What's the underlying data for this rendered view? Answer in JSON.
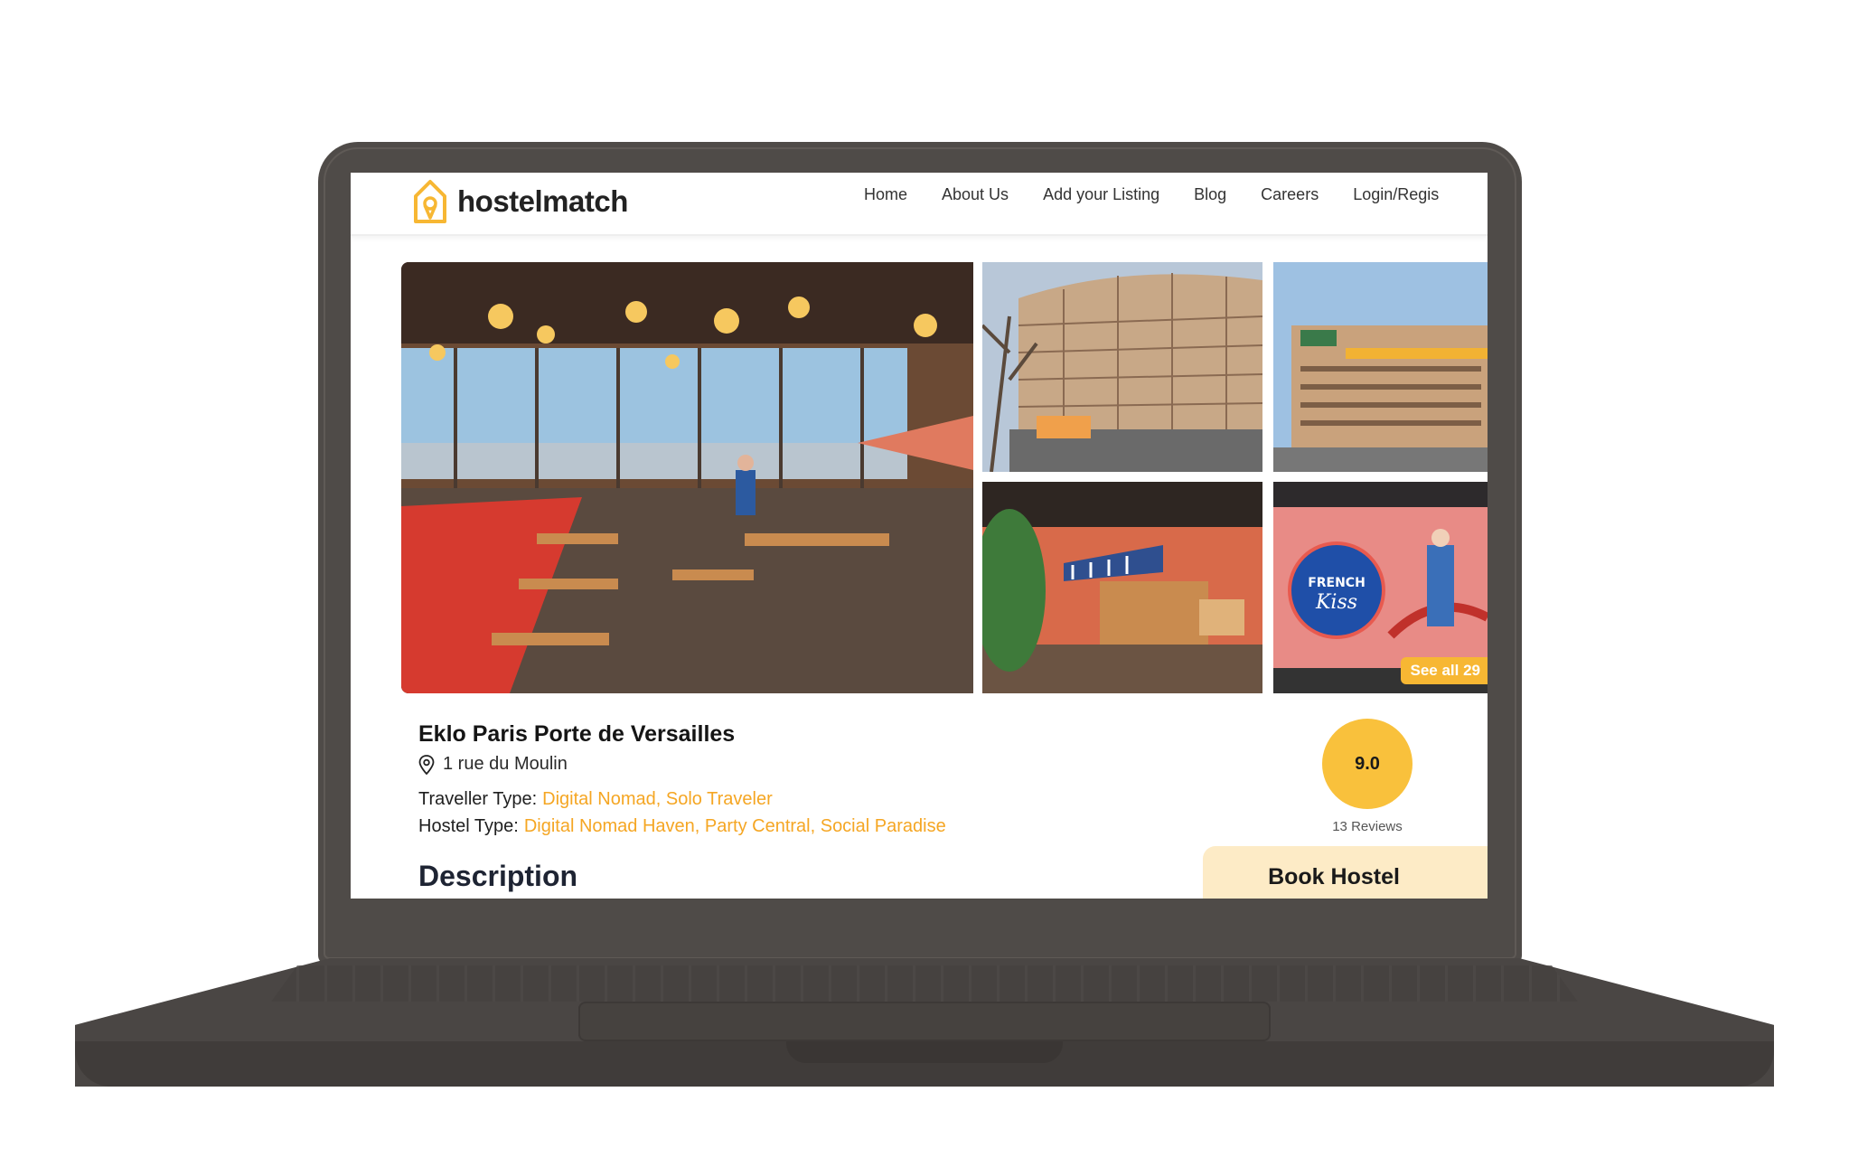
{
  "brand": {
    "name": "hostelmatch",
    "accent": "#f7b733",
    "icon": "house-pin-logo-icon"
  },
  "nav": {
    "items": [
      "Home",
      "About Us",
      "Add your Listing",
      "Blog",
      "Careers",
      "Login/Regis"
    ]
  },
  "gallery": {
    "see_all": "See all 29",
    "photos": [
      {
        "name": "restaurant-photo"
      },
      {
        "name": "building-exterior-photo"
      },
      {
        "name": "building-facade-photo"
      },
      {
        "name": "lobby-bar-photo"
      },
      {
        "name": "french-kiss-mural-photo"
      }
    ]
  },
  "listing": {
    "title": "Eklo Paris Porte de Versailles",
    "address": "1 rue du Moulin",
    "traveller_type_label": "Traveller Type:",
    "traveller_type": "Digital Nomad, Solo Traveler",
    "hostel_type_label": "Hostel Type:",
    "hostel_type": "Digital Nomad Haven, Party Central, Social Paradise",
    "description_heading": "Description"
  },
  "rating": {
    "score": "9.0",
    "reviews": "13 Reviews"
  },
  "booking": {
    "label": "Book Hostel"
  }
}
